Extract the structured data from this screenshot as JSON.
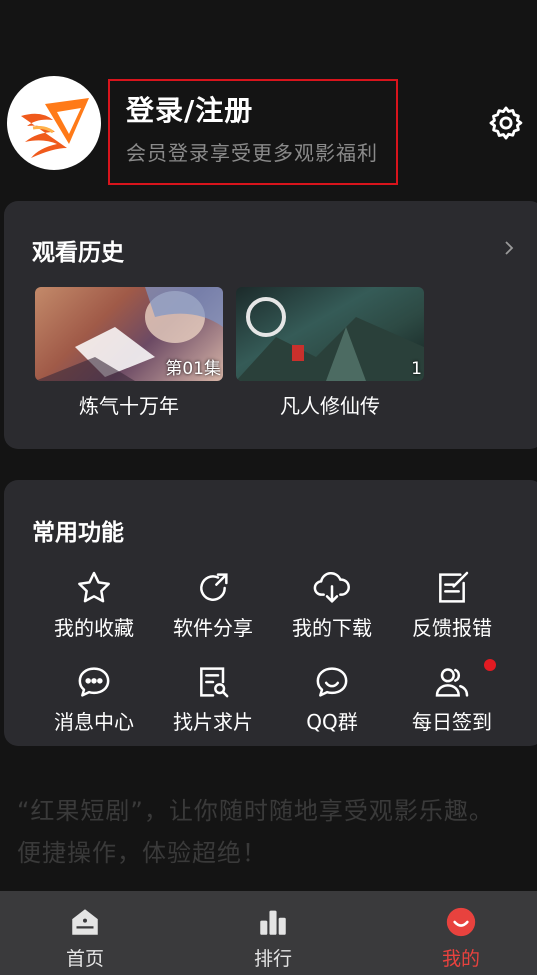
{
  "header": {
    "login_title": "登录/注册",
    "login_subtitle": "会员登录享受更多观影福利"
  },
  "history": {
    "title": "观看历史",
    "items": [
      {
        "name": "炼气十万年",
        "episode": "第01集"
      },
      {
        "name": "凡人修仙传",
        "episode": "1"
      }
    ]
  },
  "functions": {
    "title": "常用功能",
    "items": [
      {
        "label": "我的收藏",
        "icon": "star-icon"
      },
      {
        "label": "软件分享",
        "icon": "share-icon"
      },
      {
        "label": "我的下载",
        "icon": "cloud-download-icon"
      },
      {
        "label": "反馈报错",
        "icon": "edit-icon"
      },
      {
        "label": "消息中心",
        "icon": "message-icon"
      },
      {
        "label": "找片求片",
        "icon": "document-search-icon"
      },
      {
        "label": "QQ群",
        "icon": "chat-icon"
      },
      {
        "label": "每日签到",
        "icon": "users-icon"
      }
    ]
  },
  "slogan": "“红果短剧”，让你随时随地享受观影乐趣。便捷操作，体验超绝！",
  "tabs": [
    {
      "label": "首页",
      "icon": "home-icon",
      "active": false
    },
    {
      "label": "排行",
      "icon": "ranking-icon",
      "active": false
    },
    {
      "label": "我的",
      "icon": "smile-icon",
      "active": true
    }
  ],
  "colors": {
    "background": "#141414",
    "card": "#2b2b2f",
    "accent": "#e8423e",
    "highlight_border": "#d8141c"
  }
}
